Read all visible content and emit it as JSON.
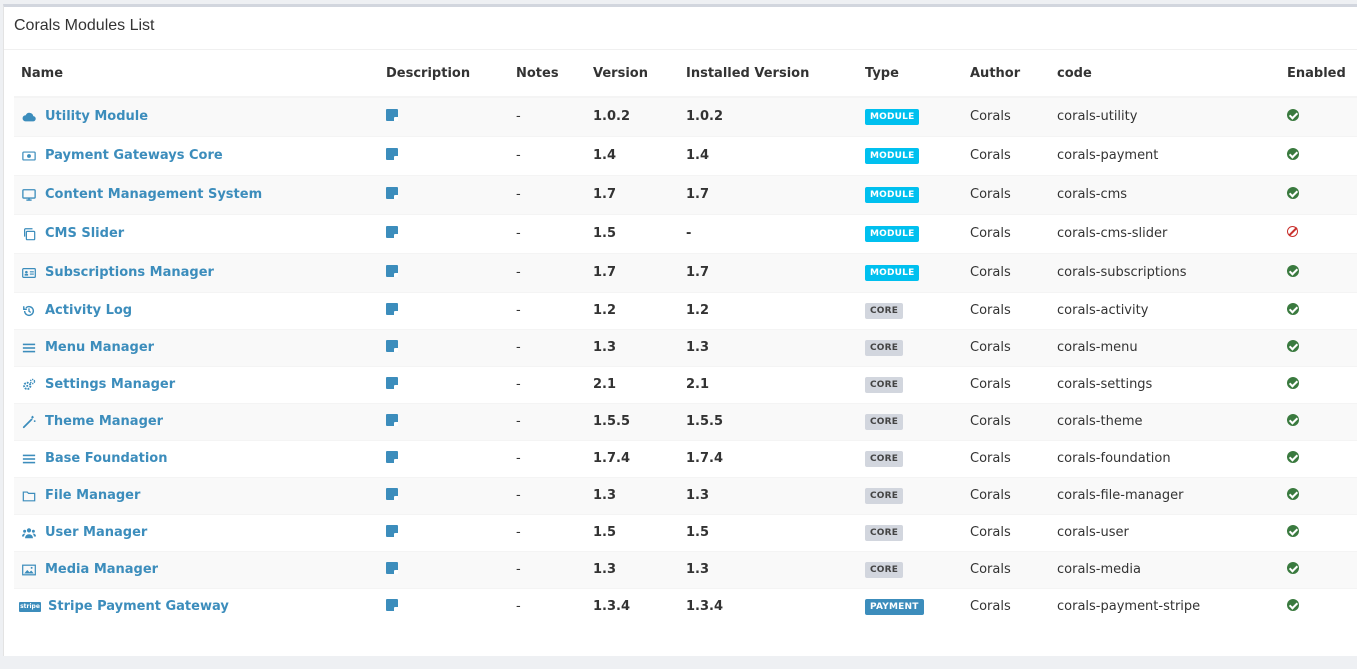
{
  "panel": {
    "title": "Corals Modules List"
  },
  "table": {
    "headers": [
      "Name",
      "Description",
      "Notes",
      "Version",
      "Installed Version",
      "Type",
      "Author",
      "code",
      "Enabled"
    ],
    "rows": [
      {
        "icon": "cloud-icon",
        "name": "Utility Module",
        "notes": "-",
        "version": "1.0.2",
        "installed": "1.0.2",
        "type": "MODULE",
        "author": "Corals",
        "code": "corals-utility",
        "enabled": true
      },
      {
        "icon": "money-icon",
        "name": "Payment Gateways Core",
        "notes": "-",
        "version": "1.4",
        "installed": "1.4",
        "type": "MODULE",
        "author": "Corals",
        "code": "corals-payment",
        "enabled": true
      },
      {
        "icon": "desktop-icon",
        "name": "Content Management System",
        "notes": "-",
        "version": "1.7",
        "installed": "1.7",
        "type": "MODULE",
        "author": "Corals",
        "code": "corals-cms",
        "enabled": true
      },
      {
        "icon": "clone-icon",
        "name": "CMS Slider",
        "notes": "-",
        "version": "1.5",
        "installed": "-",
        "type": "MODULE",
        "author": "Corals",
        "code": "corals-cms-slider",
        "enabled": false
      },
      {
        "icon": "id-card-icon",
        "name": "Subscriptions Manager",
        "notes": "-",
        "version": "1.7",
        "installed": "1.7",
        "type": "MODULE",
        "author": "Corals",
        "code": "corals-subscriptions",
        "enabled": true
      },
      {
        "icon": "history-icon",
        "name": "Activity Log",
        "notes": "-",
        "version": "1.2",
        "installed": "1.2",
        "type": "CORE",
        "author": "Corals",
        "code": "corals-activity",
        "enabled": true
      },
      {
        "icon": "bars-icon",
        "name": "Menu Manager",
        "notes": "-",
        "version": "1.3",
        "installed": "1.3",
        "type": "CORE",
        "author": "Corals",
        "code": "corals-menu",
        "enabled": true
      },
      {
        "icon": "cogs-icon",
        "name": "Settings Manager",
        "notes": "-",
        "version": "2.1",
        "installed": "2.1",
        "type": "CORE",
        "author": "Corals",
        "code": "corals-settings",
        "enabled": true
      },
      {
        "icon": "magic-wand-icon",
        "name": "Theme Manager",
        "notes": "-",
        "version": "1.5.5",
        "installed": "1.5.5",
        "type": "CORE",
        "author": "Corals",
        "code": "corals-theme",
        "enabled": true
      },
      {
        "icon": "bars-icon",
        "name": "Base Foundation",
        "notes": "-",
        "version": "1.7.4",
        "installed": "1.7.4",
        "type": "CORE",
        "author": "Corals",
        "code": "corals-foundation",
        "enabled": true
      },
      {
        "icon": "folder-icon",
        "name": "File Manager",
        "notes": "-",
        "version": "1.3",
        "installed": "1.3",
        "type": "CORE",
        "author": "Corals",
        "code": "corals-file-manager",
        "enabled": true
      },
      {
        "icon": "users-icon",
        "name": "User Manager",
        "notes": "-",
        "version": "1.5",
        "installed": "1.5",
        "type": "CORE",
        "author": "Corals",
        "code": "corals-user",
        "enabled": true
      },
      {
        "icon": "image-icon",
        "name": "Media Manager",
        "notes": "-",
        "version": "1.3",
        "installed": "1.3",
        "type": "CORE",
        "author": "Corals",
        "code": "corals-media",
        "enabled": true
      },
      {
        "icon": "stripe-icon",
        "name": "Stripe Payment Gateway",
        "notes": "-",
        "version": "1.3.4",
        "installed": "1.3.4",
        "type": "PAYMENT",
        "author": "Corals",
        "code": "corals-payment-stripe",
        "enabled": true
      }
    ]
  },
  "colors": {
    "link": "#3c8dbc",
    "module_label": "#00c0ef",
    "core_label": "#d2d6de",
    "payment_label": "#3c8dbc",
    "enabled": "#3a7a3f",
    "disabled": "#c9302c"
  },
  "icons": {
    "stripe_text": "stripe"
  }
}
